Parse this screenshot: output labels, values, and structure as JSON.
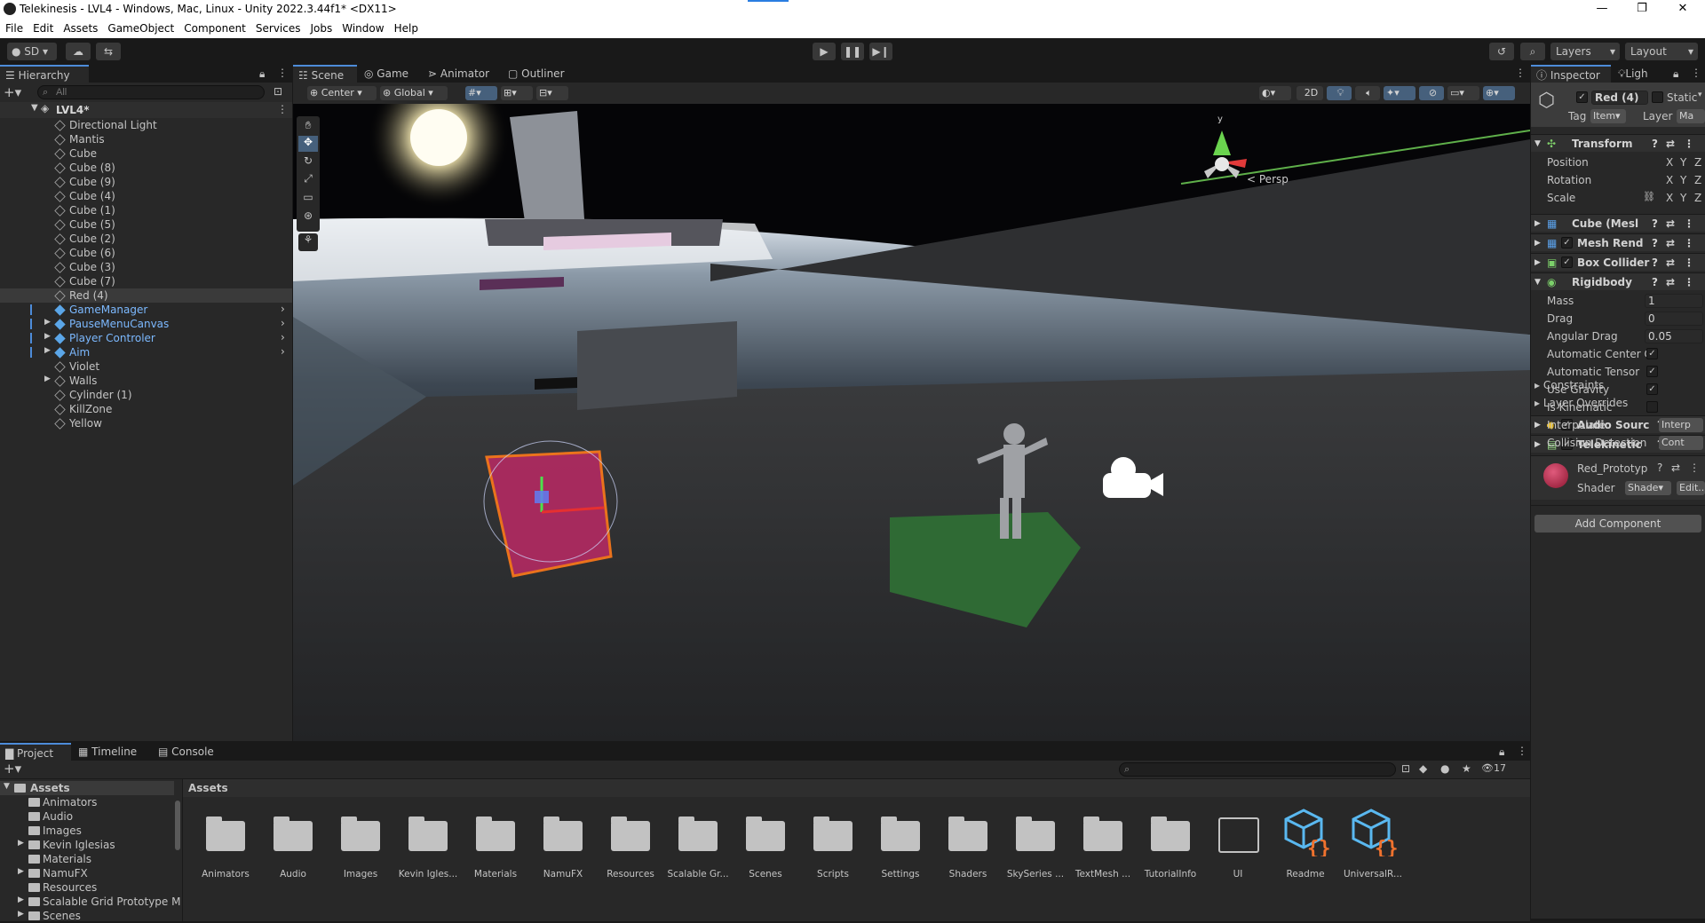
{
  "window": {
    "title": "Telekinesis - LVL4 - Windows, Mac, Linux - Unity 2022.3.44f1* <DX11>",
    "min": "—",
    "max": "❐",
    "close": "✕"
  },
  "menu": [
    "File",
    "Edit",
    "Assets",
    "GameObject",
    "Component",
    "Services",
    "Jobs",
    "Window",
    "Help"
  ],
  "toolbar": {
    "account": "SD",
    "layers": "Layers",
    "layout": "Layout"
  },
  "hierarchy": {
    "tab": "Hierarchy",
    "search_placeholder": "All",
    "scene": "LVL4*",
    "items": [
      {
        "label": "Directional Light",
        "indent": 0,
        "type": "object"
      },
      {
        "label": "Mantis",
        "indent": 0,
        "type": "object"
      },
      {
        "label": "Cube",
        "indent": 0,
        "type": "object"
      },
      {
        "label": "Cube (8)",
        "indent": 0,
        "type": "object"
      },
      {
        "label": "Cube (9)",
        "indent": 0,
        "type": "object"
      },
      {
        "label": "Cube (4)",
        "indent": 0,
        "type": "object"
      },
      {
        "label": "Cube (1)",
        "indent": 0,
        "type": "object"
      },
      {
        "label": "Cube (5)",
        "indent": 0,
        "type": "object"
      },
      {
        "label": "Cube (2)",
        "indent": 0,
        "type": "object"
      },
      {
        "label": "Cube (6)",
        "indent": 0,
        "type": "object"
      },
      {
        "label": "Cube (3)",
        "indent": 0,
        "type": "object"
      },
      {
        "label": "Cube (7)",
        "indent": 0,
        "type": "object"
      },
      {
        "label": "Red (4)",
        "indent": 0,
        "type": "object",
        "selected": true
      },
      {
        "label": "GameManager",
        "indent": 0,
        "type": "prefab"
      },
      {
        "label": "PauseMenuCanvas",
        "indent": 0,
        "type": "prefab",
        "arrow": true
      },
      {
        "label": "Player Controler",
        "indent": 0,
        "type": "prefab",
        "arrow": true
      },
      {
        "label": "Aim",
        "indent": 0,
        "type": "prefab",
        "arrow": true
      },
      {
        "label": "Violet",
        "indent": 0,
        "type": "object"
      },
      {
        "label": "Walls",
        "indent": 0,
        "type": "object",
        "arrow": true
      },
      {
        "label": "Cylinder (1)",
        "indent": 0,
        "type": "object"
      },
      {
        "label": "KillZone",
        "indent": 0,
        "type": "object"
      },
      {
        "label": "Yellow",
        "indent": 0,
        "type": "object"
      }
    ]
  },
  "scene_tabs": [
    "Scene",
    "Game",
    "Animator",
    "Outliner"
  ],
  "scene_toolbar": {
    "pivot": "Center",
    "space": "Global",
    "mode2d": "2D",
    "persp": "Persp"
  },
  "inspector": {
    "tabs": [
      "Inspector",
      "Ligh"
    ],
    "object_name": "Red (4)",
    "static": "Static",
    "tag_label": "Tag",
    "tag_value": "Item",
    "layer_label": "Layer",
    "layer_value": "Ma",
    "transform": {
      "title": "Transform",
      "rows": [
        "Position",
        "Rotation",
        "Scale"
      ],
      "axes": [
        "X",
        "Y",
        "Z"
      ]
    },
    "components": [
      "Cube (Mesl",
      "Mesh Rend",
      "Box Collider",
      "Rigidbody"
    ],
    "rigidbody": [
      {
        "label": "Mass",
        "value": "1",
        "kind": "field"
      },
      {
        "label": "Drag",
        "value": "0",
        "kind": "field"
      },
      {
        "label": "Angular Drag",
        "value": "0.05",
        "kind": "field"
      },
      {
        "label": "Automatic Center Of I",
        "value": "✓",
        "kind": "check"
      },
      {
        "label": "Automatic Tensor",
        "value": "✓",
        "kind": "check"
      },
      {
        "label": "Use Gravity",
        "value": "✓",
        "kind": "check"
      },
      {
        "label": "Is Kinematic",
        "value": "",
        "kind": "check"
      },
      {
        "label": "Interpolate",
        "value": "Interp",
        "kind": "drop"
      },
      {
        "label": "Collision Detection",
        "value": "Cont",
        "kind": "drop"
      }
    ],
    "foldouts": [
      "Constraints",
      "Layer Overrides"
    ],
    "more_components": [
      "Audio Sourc",
      "Telekinetic"
    ],
    "material": {
      "name": "Red_Prototyp",
      "shader_label": "Shader",
      "shader_value": "Shade",
      "edit": "Edit..."
    },
    "add_component": "Add Component"
  },
  "project": {
    "tabs": [
      "Project",
      "Timeline",
      "Console"
    ],
    "count": "17",
    "breadcrumb": "Assets",
    "tree": [
      "Assets",
      "Animators",
      "Audio",
      "Images",
      "Kevin Iglesias",
      "Materials",
      "NamuFX",
      "Resources",
      "Scalable Grid Prototype M",
      "Scenes"
    ],
    "assets": [
      {
        "label": "Animators",
        "kind": "folder"
      },
      {
        "label": "Audio",
        "kind": "folder"
      },
      {
        "label": "Images",
        "kind": "folder"
      },
      {
        "label": "Kevin Igles...",
        "kind": "folder"
      },
      {
        "label": "Materials",
        "kind": "folder"
      },
      {
        "label": "NamuFX",
        "kind": "folder"
      },
      {
        "label": "Resources",
        "kind": "folder"
      },
      {
        "label": "Scalable Gr...",
        "kind": "folder"
      },
      {
        "label": "Scenes",
        "kind": "folder"
      },
      {
        "label": "Scripts",
        "kind": "folder"
      },
      {
        "label": "Settings",
        "kind": "folder"
      },
      {
        "label": "Shaders",
        "kind": "folder"
      },
      {
        "label": "SkySeries ...",
        "kind": "folder"
      },
      {
        "label": "TextMesh ...",
        "kind": "folder"
      },
      {
        "label": "TutorialInfo",
        "kind": "folder"
      },
      {
        "label": "UI",
        "kind": "empty-folder"
      },
      {
        "label": "Readme",
        "kind": "package"
      },
      {
        "label": "UniversalR...",
        "kind": "package"
      }
    ]
  }
}
